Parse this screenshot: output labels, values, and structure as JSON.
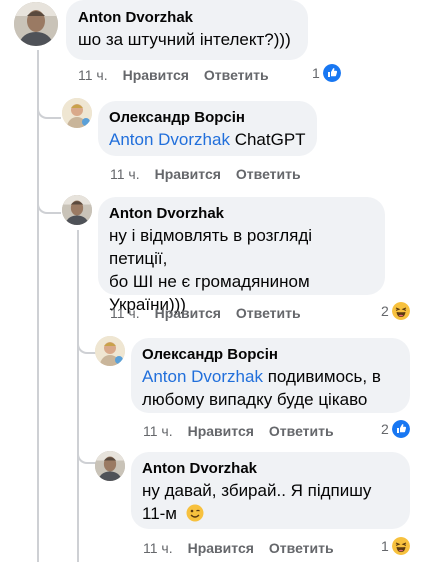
{
  "comments": [
    {
      "author": "Anton Dvorzhak",
      "text": "шо за штучний інтелект?)))",
      "time": "11 ч.",
      "like_label": "Нравится",
      "reply_label": "Ответить",
      "reaction_count": "1",
      "reaction_icon": "like-icon"
    },
    {
      "author": "Олександр Ворсін",
      "mention": "Anton Dvorzhak",
      "text": "ChatGPT",
      "time": "11 ч.",
      "like_label": "Нравится",
      "reply_label": "Ответить"
    },
    {
      "author": "Anton Dvorzhak",
      "text_lines": [
        "ну і відмовлять в розгляді петиції,",
        "бо ШІ не є громадянином",
        "України)))"
      ],
      "time": "11 ч.",
      "like_label": "Нравится",
      "reply_label": "Ответить",
      "reaction_count": "2",
      "reaction_icon": "haha-icon"
    },
    {
      "author": "Олександр Ворсін",
      "mention": "Anton Dvorzhak",
      "text": "подивимось, в",
      "text_line2": "любому випадку буде цікаво",
      "time": "11 ч.",
      "like_label": "Нравится",
      "reply_label": "Ответить",
      "reaction_count": "2",
      "reaction_icon": "like-icon"
    },
    {
      "author": "Anton Dvorzhak",
      "text_lines": [
        "ну давай, збирай.. Я підпишу",
        "11-м"
      ],
      "emoji": "wink-emoji",
      "time": "11 ч.",
      "like_label": "Нравится",
      "reply_label": "Ответить",
      "reaction_count": "1",
      "reaction_icon": "haha-icon"
    }
  ],
  "colors": {
    "bubble": "#f0f2f5",
    "mention": "#216fdb",
    "meta": "#65676b",
    "like_blue": "#1877f2",
    "thread_line": "#ced0d4"
  }
}
